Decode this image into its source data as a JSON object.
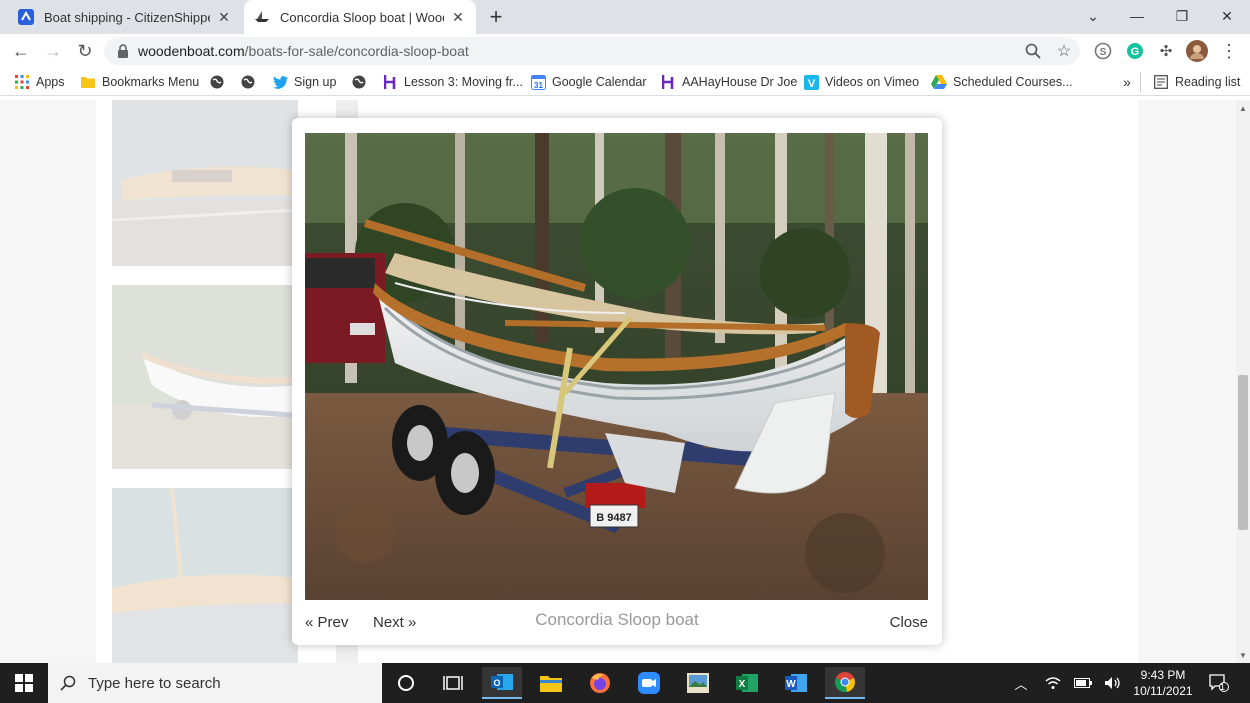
{
  "browser": {
    "tabs": [
      {
        "title": "Boat shipping - CitizenShipper",
        "active": false
      },
      {
        "title": "Concordia Sloop boat | WoodenBoat",
        "active": true
      }
    ],
    "url_host": "woodenboat.com",
    "url_path": "/boats-for-sale/concordia-sloop-boat",
    "bookmarks": [
      {
        "label": "Apps",
        "icon": "apps-grid-icon"
      },
      {
        "label": "Bookmarks Menu",
        "icon": "folder-icon"
      },
      {
        "label": "",
        "icon": "globe-icon"
      },
      {
        "label": "",
        "icon": "globe-icon"
      },
      {
        "label": "Sign up",
        "icon": "twitter-icon"
      },
      {
        "label": "",
        "icon": "globe-icon"
      },
      {
        "label": "Lesson 3: Moving fr...",
        "icon": "h-logo-icon"
      },
      {
        "label": "Google Calendar",
        "icon": "calendar-icon"
      },
      {
        "label": "AAHayHouse Dr Joe",
        "icon": "h-logo-icon"
      },
      {
        "label": "Videos on Vimeo",
        "icon": "vimeo-icon"
      },
      {
        "label": "Scheduled Courses...",
        "icon": "drive-icon"
      }
    ],
    "overflow_label": "»",
    "reading_list_label": "Reading list"
  },
  "lightbox": {
    "prev_label": "« Prev",
    "next_label": "Next »",
    "caption": "Concordia Sloop boat",
    "close_label": "Close"
  },
  "taskbar": {
    "search_placeholder": "Type here to search",
    "time": "9:43 PM",
    "date": "10/11/2021",
    "notification_count": "1"
  },
  "colors": {
    "tab_strip": "#dee1e6",
    "taskbar": "#1f1f1f",
    "overlay": "#ffffff"
  }
}
